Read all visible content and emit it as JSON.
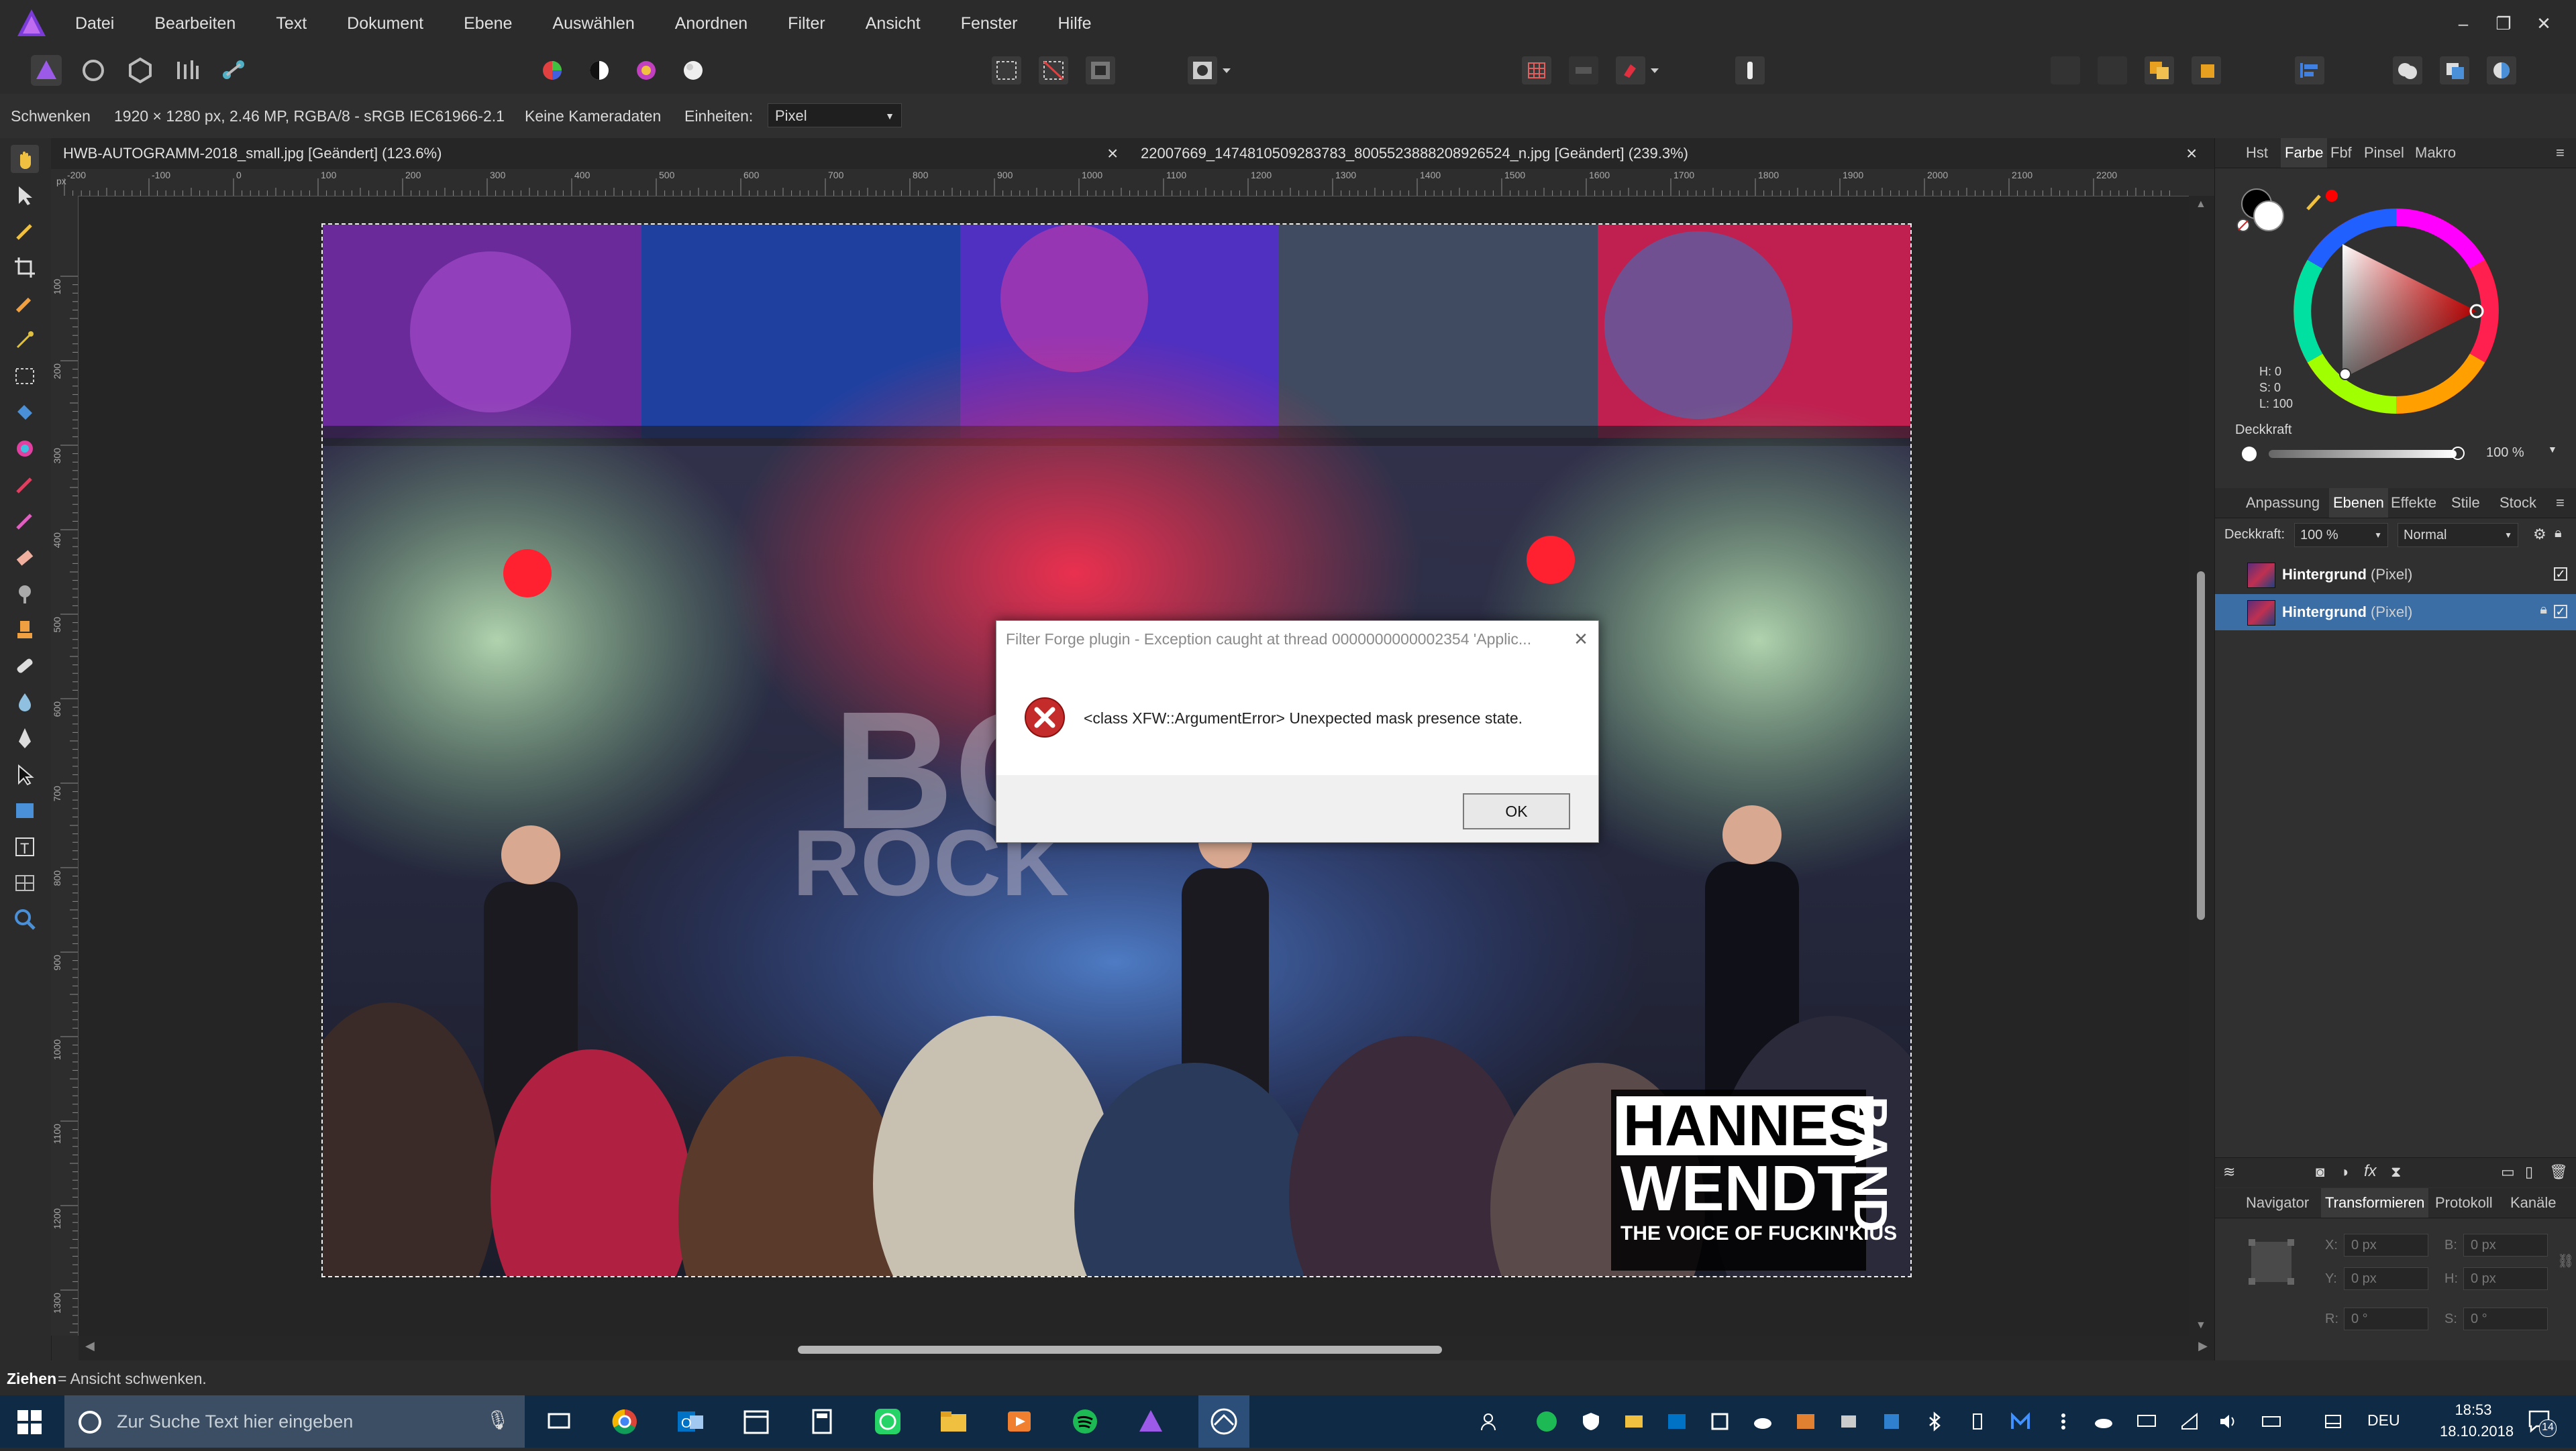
{
  "menubar": {
    "items": [
      "Datei",
      "Bearbeiten",
      "Text",
      "Dokument",
      "Ebene",
      "Auswählen",
      "Anordnen",
      "Filter",
      "Ansicht",
      "Fenster",
      "Hilfe"
    ],
    "window_controls": [
      "–",
      "❐",
      "✕"
    ]
  },
  "context_bar": {
    "tool_name": "Schwenken",
    "image_info": "1920 × 1280 px, 2.46 MP, RGBA/8 - sRGB IEC61966-2.1",
    "camera": "Keine Kameradaten",
    "units_label": "Einheiten:",
    "units_value": "Pixel"
  },
  "tabs": [
    {
      "label": "HWB-AUTOGRAMM-2018_small.jpg [Geändert] (123.6%)"
    },
    {
      "label": "22007669_1474810509283783_8005523888208926524_n.jpg [Geändert] (239.3%)"
    }
  ],
  "ruler": {
    "h_labels": [
      "-200",
      "-100",
      "0",
      "100",
      "200",
      "300",
      "400",
      "500",
      "600",
      "700",
      "800",
      "900",
      "1000",
      "1100",
      "1200",
      "1300",
      "1400",
      "1500",
      "1600",
      "1700",
      "1800",
      "1900",
      "2000",
      "2100",
      "2200"
    ],
    "v_labels": [
      "100",
      "200",
      "300",
      "400",
      "500",
      "600",
      "700",
      "800",
      "900",
      "1000",
      "1100",
      "1200",
      "1300"
    ],
    "unit_label": "px"
  },
  "photo": {
    "logo_line1": "HANNES",
    "logo_line2": "WENDT",
    "logo_side": "BAND",
    "tagline": "THE VOICE OF FUCKIN'KIUS"
  },
  "dialog": {
    "title": "Filter Forge plugin - Exception caught at thread 0000000000002354 'Applic...",
    "message": "<class XFW::ArgumentError> Unexpected mask presence state.",
    "ok_label": "OK"
  },
  "color_panel": {
    "tabs": [
      "Hst",
      "Farbe",
      "Fbf",
      "Pinsel",
      "Makro"
    ],
    "active_tab": "Farbe",
    "h": "H: 0",
    "s": "S: 0",
    "l": "L: 100",
    "opacity_label": "Deckkraft",
    "opacity_value": "100 %",
    "accent": "#ff0000"
  },
  "layers_panel": {
    "tabs": [
      "Anpassung",
      "Ebenen",
      "Effekte",
      "Stile",
      "Stock"
    ],
    "active_tab": "Ebenen",
    "opacity_label": "Deckkraft:",
    "opacity_value": "100 %",
    "blend_mode": "Normal",
    "layers": [
      {
        "name": "Hintergrund",
        "type": "(Pixel)",
        "selected": false
      },
      {
        "name": "Hintergrund",
        "type": "(Pixel)",
        "selected": true
      }
    ],
    "selected_color": "#3a6ea5"
  },
  "transform_panel": {
    "tabs": [
      "Navigator",
      "Transformieren",
      "Protokoll",
      "Kanäle"
    ],
    "active_tab": "Transformieren",
    "x_label": "X:",
    "x_value": "0 px",
    "y_label": "Y:",
    "y_value": "0 px",
    "b_label": "B:",
    "b_value": "0 px",
    "h_label": "H:",
    "h_value": "0 px",
    "r_label": "R:",
    "r_value": "0 °",
    "s_label": "S:",
    "s_value": "0 °"
  },
  "statusbar": {
    "key": "Ziehen",
    "text": " = Ansicht schwenken."
  },
  "taskbar": {
    "search_placeholder": "Zur Suche Text hier eingeben",
    "language": "DEU",
    "time": "18:53",
    "date": "18.10.2018",
    "notification_count": "14"
  }
}
